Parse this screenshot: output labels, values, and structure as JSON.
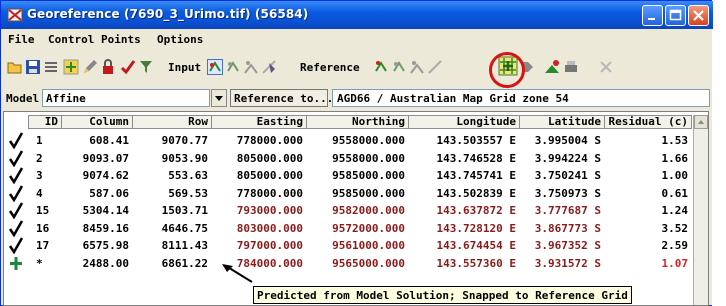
{
  "window": {
    "title": "Georeference (7690_3_Urimo.tif) (56584)",
    "title_color": "#ffffff",
    "titlebar_color": "#0a5ae0"
  },
  "menu": [
    "File",
    "Control Points",
    "Options"
  ],
  "toolbar": {
    "input_label": "Input",
    "reference_label": "Reference",
    "icons_left": [
      "open-icon",
      "save-icon",
      "list-icon",
      "add-point-icon",
      "edit-icon",
      "lock-icon",
      "check-icon",
      "filter-icon"
    ],
    "icons_input": [
      "input-view-icon",
      "input-view-2-icon",
      "input-snap-icon",
      "input-snap-2-icon"
    ],
    "icons_reference": [
      "reference-view-icon",
      "reference-view-2-icon",
      "reference-snap-icon",
      "snap-to-grid-icon",
      "snap-arrow-icon"
    ],
    "icons_right": [
      "layer-icon",
      "print-icon",
      "close-icon"
    ]
  },
  "model": {
    "label": "Model",
    "value": "Affine",
    "reference_button": "Reference to...",
    "reference_system": "AGD66 / Australian Map Grid zone 54"
  },
  "table": {
    "headers": [
      "ID",
      "Column",
      "Row",
      "Easting",
      "Northing",
      "Longitude",
      "Latitude",
      "Residual (c)"
    ],
    "rows": [
      {
        "marker": "check",
        "id": "1",
        "column": "608.41",
        "row": "9070.77",
        "easting": "778000.000",
        "northing": "9558000.000",
        "longitude": "143.503557 E",
        "latitude": "3.995004 S",
        "residual": "1.53",
        "ref_color": "#000000",
        "residual_color": "#000000"
      },
      {
        "marker": "check",
        "id": "2",
        "column": "9093.07",
        "row": "9053.90",
        "easting": "805000.000",
        "northing": "9558000.000",
        "longitude": "143.746528 E",
        "latitude": "3.994224 S",
        "residual": "1.66",
        "ref_color": "#000000",
        "residual_color": "#000000"
      },
      {
        "marker": "check",
        "id": "3",
        "column": "9074.62",
        "row": "553.63",
        "easting": "805000.000",
        "northing": "9585000.000",
        "longitude": "143.745741 E",
        "latitude": "3.750241 S",
        "residual": "1.00",
        "ref_color": "#000000",
        "residual_color": "#000000"
      },
      {
        "marker": "check",
        "id": "4",
        "column": "587.06",
        "row": "569.53",
        "easting": "778000.000",
        "northing": "9585000.000",
        "longitude": "143.502839 E",
        "latitude": "3.750973 S",
        "residual": "0.61",
        "ref_color": "#000000",
        "residual_color": "#000000"
      },
      {
        "marker": "check",
        "id": "15",
        "column": "5304.14",
        "row": "1503.71",
        "easting": "793000.000",
        "northing": "9582000.000",
        "longitude": "143.637872 E",
        "latitude": "3.777687 S",
        "residual": "1.24",
        "ref_color": "#8b1a1a",
        "residual_color": "#000000"
      },
      {
        "marker": "check",
        "id": "16",
        "column": "8459.16",
        "row": "4646.75",
        "easting": "803000.000",
        "northing": "9572000.000",
        "longitude": "143.728120 E",
        "latitude": "3.867773 S",
        "residual": "3.52",
        "ref_color": "#8b1a1a",
        "residual_color": "#000000"
      },
      {
        "marker": "check",
        "id": "17",
        "column": "6575.98",
        "row": "8111.43",
        "easting": "797000.000",
        "northing": "9561000.000",
        "longitude": "143.674454 E",
        "latitude": "3.967352 S",
        "residual": "2.59",
        "ref_color": "#8b1a1a",
        "residual_color": "#000000"
      },
      {
        "marker": "plus",
        "id": "*",
        "column": "2488.00",
        "row": "6861.22",
        "easting": "784000.000",
        "northing": "9565000.000",
        "longitude": "143.557360 E",
        "latitude": "3.931572 S",
        "residual": "1.07",
        "ref_color": "#8b1a1a",
        "residual_color": "#e02020"
      }
    ]
  },
  "tooltip": "Predicted from Model Solution; Snapped to Reference Grid",
  "colors": {
    "highlight_circle": "#d61414",
    "predicted_text": "#8b1a1a",
    "residual_highlight": "#e02020",
    "check_mark": "#000000",
    "plus_marker": "#1a8a3a"
  }
}
